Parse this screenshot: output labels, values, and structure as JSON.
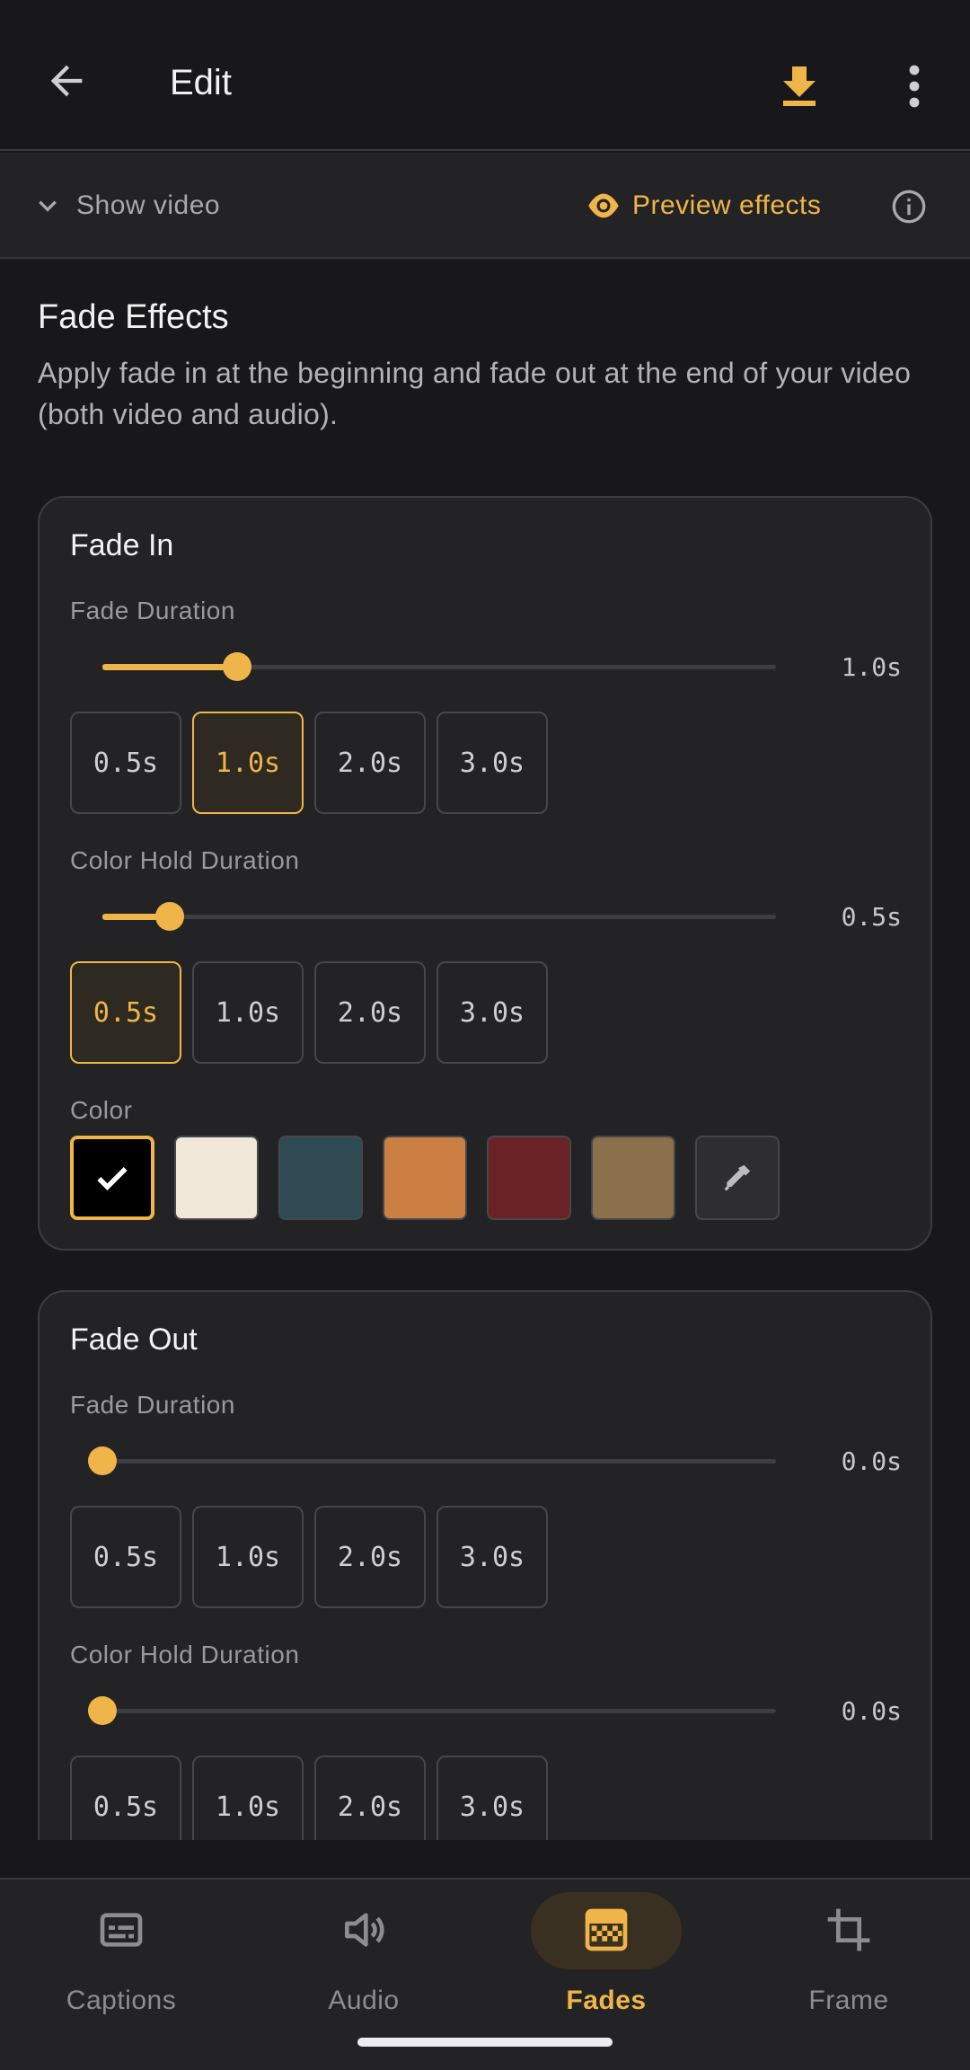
{
  "header": {
    "title": "Edit"
  },
  "subbar": {
    "show_video_label": "Show video",
    "preview_label": "Preview effects"
  },
  "section": {
    "title": "Fade Effects",
    "description": "Apply fade in at the beginning and fade out at the end of your video (both video and audio)."
  },
  "fade_in": {
    "title": "Fade In",
    "fade_duration_label": "Fade Duration",
    "fade_duration_value": "1.0s",
    "fade_duration_slider": 0.2,
    "fade_duration_chips": [
      "0.5s",
      "1.0s",
      "2.0s",
      "3.0s"
    ],
    "fade_duration_selected": "1.0s",
    "hold_label": "Color Hold Duration",
    "hold_value": "0.5s",
    "hold_slider": 0.1,
    "hold_chips": [
      "0.5s",
      "1.0s",
      "2.0s",
      "3.0s"
    ],
    "hold_selected": "0.5s",
    "color_label": "Color",
    "colors": [
      "#000000",
      "#f1e8d9",
      "#2f4a53",
      "#cb7f42",
      "#6b2226",
      "#8b704c"
    ],
    "selected_color": "#000000"
  },
  "fade_out": {
    "title": "Fade Out",
    "fade_duration_label": "Fade Duration",
    "fade_duration_value": "0.0s",
    "fade_duration_slider": 0.0,
    "fade_duration_chips": [
      "0.5s",
      "1.0s",
      "2.0s",
      "3.0s"
    ],
    "hold_label": "Color Hold Duration",
    "hold_value": "0.0s",
    "hold_slider": 0.0,
    "hold_chips": [
      "0.5s",
      "1.0s",
      "2.0s",
      "3.0s"
    ]
  },
  "nav": {
    "items": [
      "Captions",
      "Audio",
      "Fades",
      "Frame"
    ],
    "selected": "Fades"
  },
  "colors": {
    "accent": "#f0b548",
    "background": "#18181a",
    "surface": "#232325"
  }
}
